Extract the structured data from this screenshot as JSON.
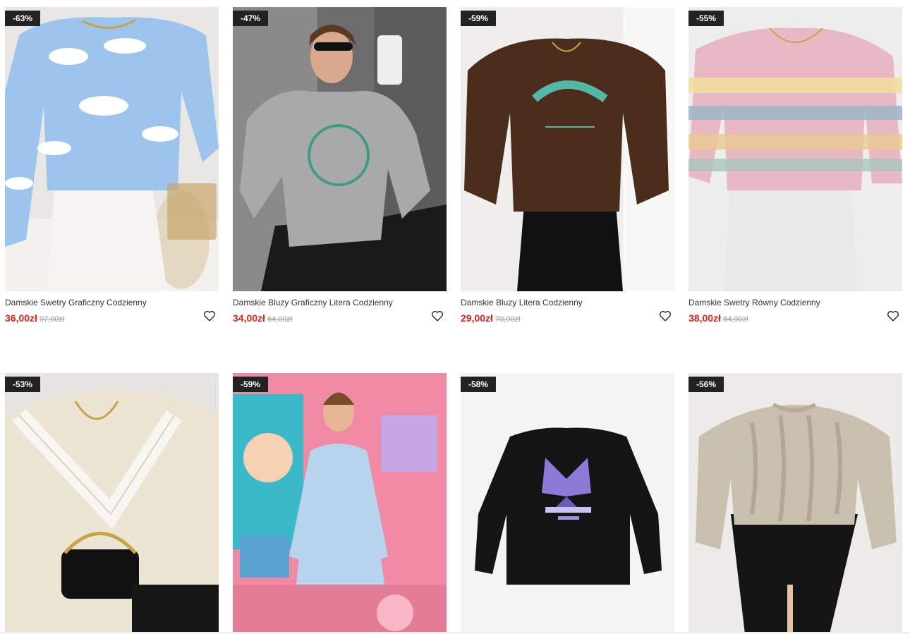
{
  "colors": {
    "price": "#e2231a",
    "badge_bg": "#222222",
    "old_price": "#999999"
  },
  "products": [
    {
      "discount": "-63%",
      "title": "Damskie Swetry Graficzny Codzienny",
      "price": "36,00zł",
      "old_price": "97,00zł",
      "image": "blue-cloud-sweater-photo",
      "wishlist_icon": "heart-outline-icon"
    },
    {
      "discount": "-47%",
      "title": "Damskie Bluzy Graficzny Litera Codzienny",
      "price": "34,00zł",
      "old_price": "64,00zł",
      "image": "grey-tennis-hoodie-photo",
      "wishlist_icon": "heart-outline-icon"
    },
    {
      "discount": "-59%",
      "title": "Damskie Bluzy Litera Codzienny",
      "price": "29,00zł",
      "old_price": "70,00zł",
      "image": "brown-los-angeles-sweatshirt-photo",
      "wishlist_icon": "heart-outline-icon"
    },
    {
      "discount": "-55%",
      "title": "Damskie Swetry Równy Codzienny",
      "price": "38,00zł",
      "old_price": "84,00zł",
      "image": "rainbow-stripe-sweater-photo",
      "wishlist_icon": "heart-outline-icon"
    },
    {
      "discount": "-53%",
      "image": "cream-lace-vneck-sweater-photo"
    },
    {
      "discount": "-59%",
      "image": "light-blue-dress-photo"
    },
    {
      "discount": "-58%",
      "image": "black-butterfly-sweatshirt-photo"
    },
    {
      "discount": "-56%",
      "image": "beige-cable-knit-sweater-photo"
    }
  ]
}
